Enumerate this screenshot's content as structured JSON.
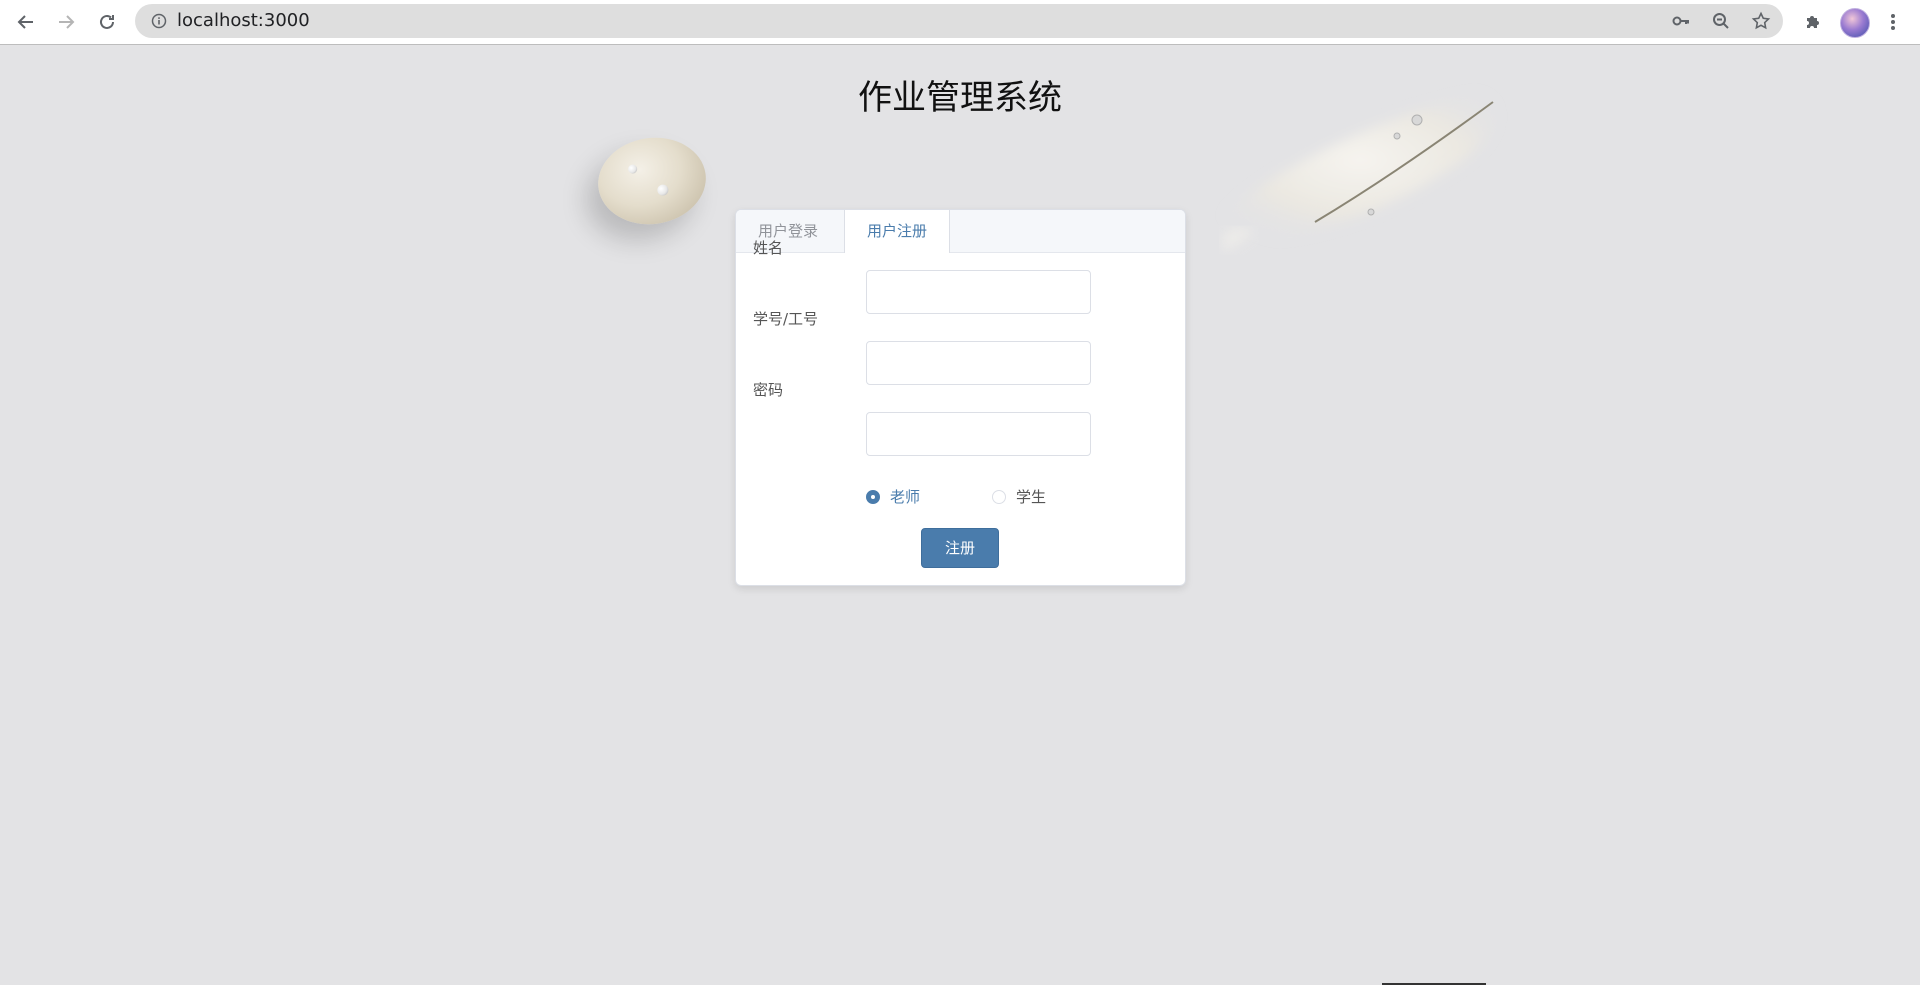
{
  "browser": {
    "url": "localhost:3000"
  },
  "page": {
    "title": "作业管理系统"
  },
  "tabs": [
    {
      "label": "用户登录",
      "active": false
    },
    {
      "label": "用户注册",
      "active": true
    }
  ],
  "form": {
    "fields": [
      {
        "label": "姓名",
        "value": ""
      },
      {
        "label": "学号/工号",
        "value": ""
      },
      {
        "label": "密码",
        "value": ""
      }
    ],
    "role_options": [
      {
        "label": "老师",
        "checked": true
      },
      {
        "label": "学生",
        "checked": false
      }
    ],
    "submit_label": "注册"
  },
  "colors": {
    "accent": "#4a7cac",
    "page_background": "#e3e3e5"
  }
}
